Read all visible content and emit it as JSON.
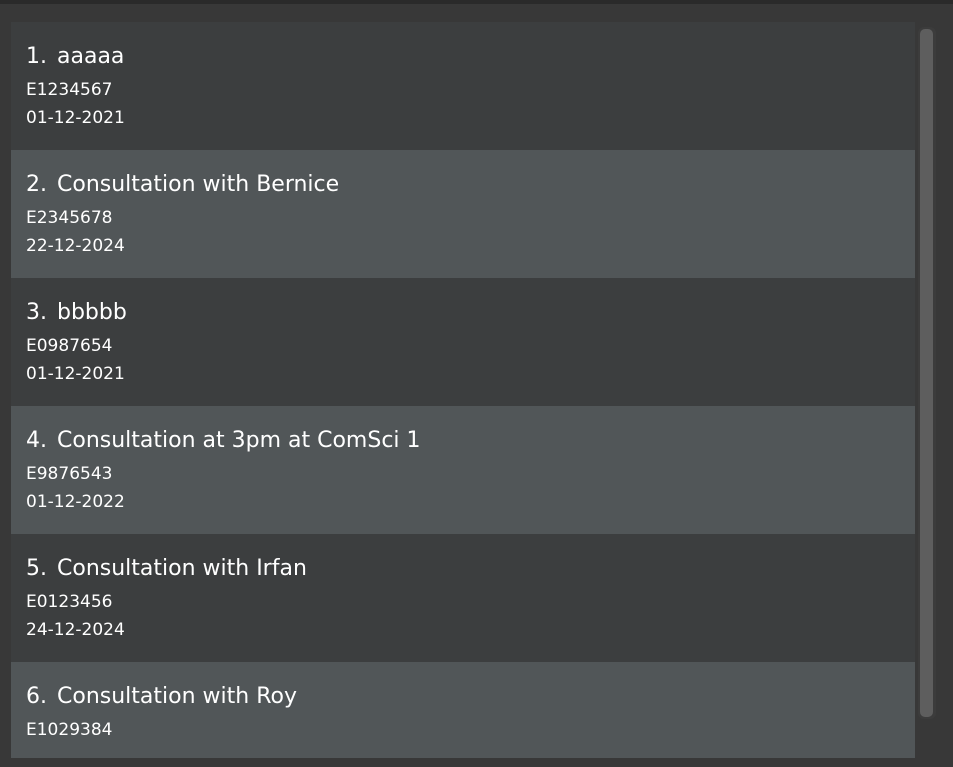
{
  "appointments": [
    {
      "index": "1.",
      "title": "aaaaa",
      "id": "E1234567",
      "date": "01-12-2021"
    },
    {
      "index": "2.",
      "title": "Consultation with Bernice",
      "id": "E2345678",
      "date": "22-12-2024"
    },
    {
      "index": "3.",
      "title": "bbbbb",
      "id": "E0987654",
      "date": "01-12-2021"
    },
    {
      "index": "4.",
      "title": "Consultation at 3pm at ComSci 1",
      "id": "E9876543",
      "date": "01-12-2022"
    },
    {
      "index": "5.",
      "title": "Consultation with Irfan",
      "id": "E0123456",
      "date": "24-12-2024"
    },
    {
      "index": "6.",
      "title": "Consultation with Roy",
      "id": "E1029384",
      "date": ""
    }
  ],
  "colors": {
    "background": "#383838",
    "card_dark": "#3c3e3f",
    "card_light": "#515658",
    "text": "#ffffff",
    "scrollbar_thumb": "#5e5e5e"
  }
}
